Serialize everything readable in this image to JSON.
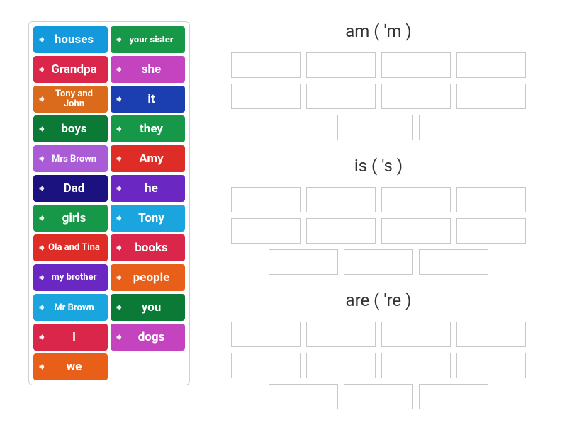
{
  "tiles": [
    {
      "label": "houses",
      "color": "c-lblue",
      "two_line": false
    },
    {
      "label": "your sister",
      "color": "c-green",
      "two_line": false,
      "small": true
    },
    {
      "label": "Grandpa",
      "color": "c-crimson",
      "two_line": false
    },
    {
      "label": "she",
      "color": "c-magenta",
      "two_line": false
    },
    {
      "label": "Tony and John",
      "color": "c-orange",
      "two_line": true
    },
    {
      "label": "it",
      "color": "c-royal",
      "two_line": false
    },
    {
      "label": "boys",
      "color": "c-dgreen",
      "two_line": false
    },
    {
      "label": "they",
      "color": "c-green",
      "two_line": false
    },
    {
      "label": "Mrs Brown",
      "color": "c-lilac",
      "two_line": false,
      "small": true
    },
    {
      "label": "Amy",
      "color": "c-red",
      "two_line": false
    },
    {
      "label": "Dad",
      "color": "c-navy",
      "two_line": false
    },
    {
      "label": "he",
      "color": "c-purple",
      "two_line": false
    },
    {
      "label": "girls",
      "color": "c-green",
      "two_line": false
    },
    {
      "label": "Tony",
      "color": "c-sky",
      "two_line": false
    },
    {
      "label": "Ola and Tina",
      "color": "c-red",
      "two_line": true
    },
    {
      "label": "books",
      "color": "c-crimson",
      "two_line": false
    },
    {
      "label": "my brother",
      "color": "c-purple",
      "two_line": true
    },
    {
      "label": "people",
      "color": "c-dorange",
      "two_line": false
    },
    {
      "label": "Mr Brown",
      "color": "c-sky",
      "two_line": false,
      "small": true
    },
    {
      "label": "you",
      "color": "c-dgreen",
      "two_line": false
    },
    {
      "label": "I",
      "color": "c-crimson",
      "two_line": false
    },
    {
      "label": "dogs",
      "color": "c-magenta",
      "two_line": false
    },
    {
      "label": "we",
      "color": "c-dorange",
      "two_line": false
    }
  ],
  "groups": [
    {
      "title": "am ( 'm )",
      "slot_count": 11
    },
    {
      "title": "is ( 's )",
      "slot_count": 11
    },
    {
      "title": "are ( 're )",
      "slot_count": 11
    }
  ]
}
